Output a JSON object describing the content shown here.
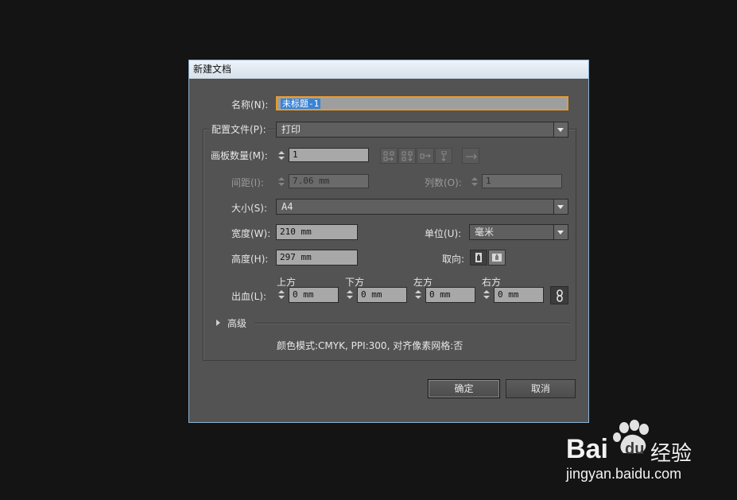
{
  "dialog": {
    "title": "新建文档",
    "name_label": "名称(N):",
    "name_value": "未标题-1",
    "profile_label": "配置文件(P):",
    "profile_value": "打印",
    "artboards_label": "画板数量(M):",
    "artboards_value": "1",
    "spacing_label": "间距(I):",
    "spacing_value": "7.06 mm",
    "columns_label": "列数(O):",
    "columns_value": "1",
    "size_label": "大小(S):",
    "size_value": "A4",
    "width_label": "宽度(W):",
    "width_value": "210 mm",
    "units_label": "单位(U):",
    "units_value": "毫米",
    "height_label": "高度(H):",
    "height_value": "297 mm",
    "orientation_label": "取向:",
    "bleed_label": "出血(L):",
    "bleed": {
      "top_label": "上方",
      "top_value": "0 mm",
      "bottom_label": "下方",
      "bottom_value": "0 mm",
      "left_label": "左方",
      "left_value": "0 mm",
      "right_label": "右方",
      "right_value": "0 mm"
    },
    "advanced_label": "高级",
    "summary": "颜色模式:CMYK, PPI:300, 对齐像素网格:否",
    "ok_label": "确定",
    "cancel_label": "取消"
  },
  "watermark": {
    "brand_text": "Bai",
    "brand_text2": "du",
    "brand_suffix": "经验",
    "url": "jingyan.baidu.com"
  },
  "colors": {
    "background": "#141414",
    "dialog": "#535353",
    "focus": "#e89b2c",
    "selection": "#3a83d6"
  }
}
